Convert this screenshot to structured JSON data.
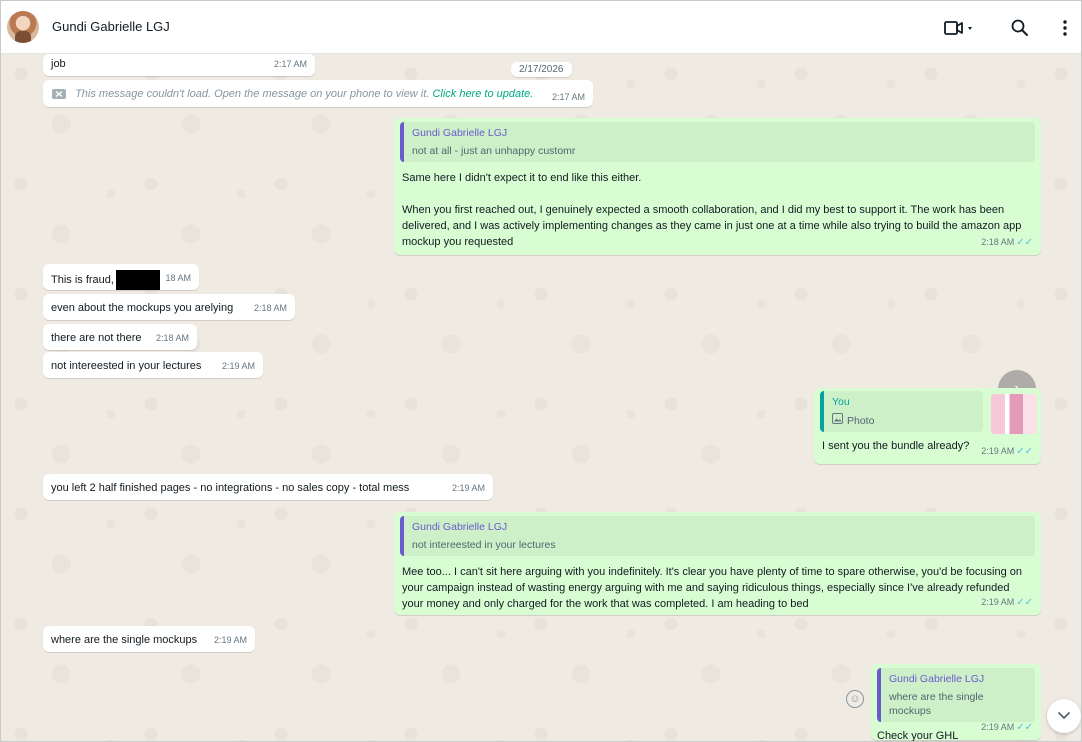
{
  "header": {
    "contact_name": "Gundi Gabrielle LGJ"
  },
  "date_separator": "2/17/2026",
  "messages": {
    "m1": {
      "text": "job",
      "time": "2:17 AM"
    },
    "m2": {
      "text": "This message couldn't load. Open the message on your phone to view it.",
      "link": "Click here to update.",
      "time": "2:17 AM"
    },
    "m3": {
      "quote_name": "Gundi Gabrielle LGJ",
      "quote_text": "not at all - just an unhappy customr",
      "text_p1": "Same here I didn't expect it to end like this either.",
      "text_p2": "When you first reached out, I genuinely expected a smooth collaboration, and I did my best to support it. The work has been delivered, and I was actively implementing changes as they came in just one at a time while also trying to build the amazon app mockup you requested",
      "time": "2:18 AM"
    },
    "m4": {
      "text": "This is fraud,",
      "time": "2:18 AM",
      "time_visible": "18 AM"
    },
    "m5": {
      "text": "even about the mockups you arelying",
      "time": "2:18 AM"
    },
    "m6": {
      "text": "there are not there",
      "time": "2:18 AM"
    },
    "m7": {
      "text": "not intereested in your lectures",
      "time": "2:19 AM"
    },
    "m8": {
      "quote_name": "You",
      "quote_text": "Photo",
      "text": "I sent you the bundle already?",
      "time": "2:19 AM"
    },
    "m9": {
      "text": "you left 2 half finished pages - no integrations - no sales copy - total mess",
      "time": "2:19 AM"
    },
    "m10": {
      "quote_name": "Gundi Gabrielle LGJ",
      "quote_text": "not intereested in your lectures",
      "text": "Mee too... I can't sit here arguing with you indefinitely. It's clear you have plenty of time to spare otherwise, you'd be focusing on your campaign instead of wasting energy arguing with me and saying ridiculous things, especially since I've already refunded your money and only charged for the work that was completed. I am heading to bed",
      "time": "2:19 AM"
    },
    "m11": {
      "text": "where are the single mockups",
      "time": "2:19 AM"
    },
    "m12": {
      "quote_name": "Gundi Gabrielle LGJ",
      "quote_text": "where are the single mockups",
      "text": "Check your GHL",
      "time": "2:19 AM"
    }
  },
  "colors": {
    "outgoing_bubble": "#d9fdd3",
    "incoming_bubble": "#ffffff",
    "chat_background": "#efeae2",
    "read_ticks": "#53bdeb",
    "quote_accent": "#6a5acd",
    "you_accent": "#06a39e"
  },
  "icons": [
    "video-camera-icon",
    "search-icon",
    "kebab-menu-icon",
    "double-check-icon",
    "photo-icon",
    "forward-icon",
    "emoji-icon",
    "chevron-down-icon",
    "error-icon"
  ]
}
